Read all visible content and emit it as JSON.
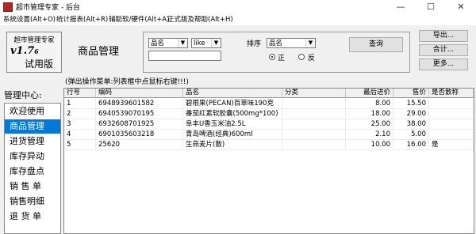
{
  "window": {
    "title": "超市管理专家 - 后台",
    "minimize": "—",
    "maximize": "☐",
    "close": "✕"
  },
  "menu": [
    "系统设置(Alt+O)",
    "统计报表(Alt+R)",
    "辅助软/硬件(Alt+A)",
    "正式版及帮助(Alt+H)"
  ],
  "logo": {
    "line1": "超市管理专家",
    "version": "v1.7",
    "version_sub": "6",
    "line3": "试用版"
  },
  "section_title": "商品管理",
  "filter": {
    "field": "品名",
    "operator": "like",
    "value": "",
    "sort_label": "排序",
    "sort_field": "品名",
    "order_asc": "正",
    "order_desc": "反",
    "query_button": "查询"
  },
  "actions": {
    "export": "导出...",
    "total": "合计...",
    "more": "更多..."
  },
  "hint": "(弹出操作菜单:列表框中点鼠标右键!!!)",
  "nav": {
    "label": "管理中心:",
    "items": [
      "欢迎使用",
      "商品管理",
      "进货管理",
      "库存异动",
      "库存盘点",
      "销 售 单",
      "销售明细",
      "退 货 单"
    ],
    "selected_index": 1
  },
  "table": {
    "columns": [
      "行号",
      "编码",
      "品名",
      "分类",
      "最后进价",
      "售价",
      "是否散称"
    ],
    "rows": [
      [
        "1",
        "6948939601582",
        "碧根果(PECAN)百草味190克",
        "",
        "8.00",
        "15.50",
        ""
      ],
      [
        "2",
        "6940539070195",
        "番茄红素软胶囊(500mg*100)",
        "",
        "18.00",
        "29.00",
        ""
      ],
      [
        "3",
        "6932608701925",
        "阜丰U香玉米油2.5L",
        "",
        "25.00",
        "38.00",
        ""
      ],
      [
        "4",
        "6901035603218",
        "青岛啤酒(经典)600ml",
        "",
        "2.10",
        "5.00",
        ""
      ],
      [
        "5",
        "25620",
        "生燕麦片(散)",
        "",
        "10.00",
        "16.00",
        "是"
      ]
    ]
  },
  "colors": {
    "selection": "#0078d7",
    "window_bg": "#f0f0f0"
  }
}
